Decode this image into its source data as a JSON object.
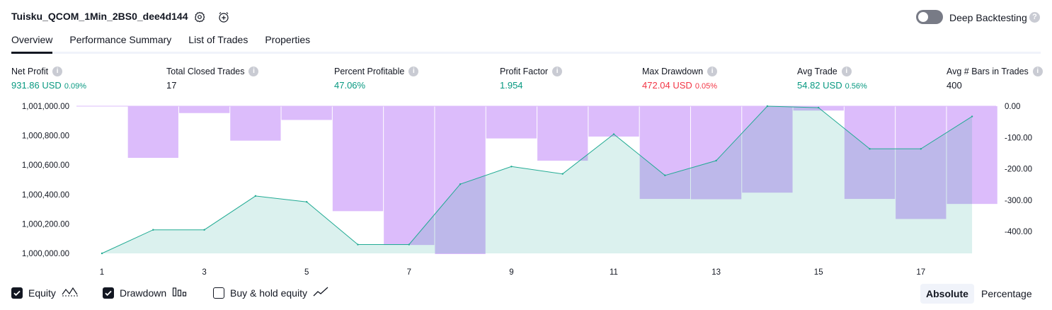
{
  "header": {
    "title": "Tuisku_QCOM_1Min_2BS0_dee4d144",
    "deep_backtesting_label": "Deep Backtesting",
    "deep_backtesting_on": false,
    "help_glyph": "?"
  },
  "tabs": [
    {
      "label": "Overview",
      "active": true
    },
    {
      "label": "Performance Summary",
      "active": false
    },
    {
      "label": "List of Trades",
      "active": false
    },
    {
      "label": "Properties",
      "active": false
    }
  ],
  "metrics": [
    {
      "label": "Net Profit",
      "value": "931.86 USD",
      "pct": "0.09%",
      "tone": "pos"
    },
    {
      "label": "Total Closed Trades",
      "value": "17",
      "pct": "",
      "tone": "neu"
    },
    {
      "label": "Percent Profitable",
      "value": "47.06%",
      "pct": "",
      "tone": "pos"
    },
    {
      "label": "Profit Factor",
      "value": "1.954",
      "pct": "",
      "tone": "pos"
    },
    {
      "label": "Max Drawdown",
      "value": "472.04 USD",
      "pct": "0.05%",
      "tone": "neg"
    },
    {
      "label": "Avg Trade",
      "value": "54.82 USD",
      "pct": "0.56%",
      "tone": "pos"
    },
    {
      "label": "Avg # Bars in Trades",
      "value": "400",
      "pct": "",
      "tone": "neu"
    }
  ],
  "colors": {
    "positive": "#089981",
    "negative": "#f23645",
    "equity_line": "#22ab94",
    "equity_fill": "#d7f1ea",
    "drawdown_fill": "#dcbcfb",
    "text": "#131722"
  },
  "chart_data": {
    "type": "line",
    "x": [
      1,
      2,
      3,
      4,
      5,
      6,
      7,
      8,
      9,
      10,
      11,
      12,
      13,
      14,
      15,
      16,
      17,
      18
    ],
    "x_tick_labels": [
      "1",
      "3",
      "5",
      "7",
      "9",
      "11",
      "13",
      "15",
      "17"
    ],
    "series": [
      {
        "name": "Equity",
        "type": "area",
        "axis": "left",
        "values": [
          1000000,
          1000160,
          1000160,
          1000390,
          1000350,
          1000060,
          1000060,
          1000470,
          1000590,
          1000540,
          1000810,
          1000530,
          1000630,
          1001000,
          1000990,
          1000710,
          1000710,
          1000930
        ]
      },
      {
        "name": "Drawdown",
        "type": "bar",
        "axis": "right",
        "values": [
          0,
          -165,
          -22,
          -110,
          -44,
          -335,
          -443,
          -472,
          -103,
          -174,
          -97,
          -296,
          -297,
          -276,
          -14,
          -296,
          -360,
          -312
        ]
      }
    ],
    "left_axis": {
      "ylim": [
        1000000,
        1001000
      ],
      "tick_labels": [
        "1,001,000.00",
        "1,000,800.00",
        "1,000,600.00",
        "1,000,400.00",
        "1,000,200.00",
        "1,000,000.00"
      ],
      "tick_values": [
        1001000,
        1000800,
        1000600,
        1000400,
        1000200,
        1000000
      ]
    },
    "right_axis": {
      "ylim": [
        -472,
        0
      ],
      "tick_labels": [
        "0.00",
        "-100.00",
        "-200.00",
        "-300.00",
        "-400.00"
      ],
      "tick_values": [
        0,
        -100,
        -200,
        -300,
        -400
      ]
    },
    "grid": false
  },
  "legend": [
    {
      "label": "Equity",
      "checked": true,
      "icon": "equity-line-icon"
    },
    {
      "label": "Drawdown",
      "checked": true,
      "icon": "drawdown-bars-icon"
    },
    {
      "label": "Buy & hold equity",
      "checked": false,
      "icon": "buy-hold-line-icon"
    }
  ],
  "scale_toggle": {
    "absolute_label": "Absolute",
    "percentage_label": "Percentage",
    "selected": "Absolute"
  }
}
